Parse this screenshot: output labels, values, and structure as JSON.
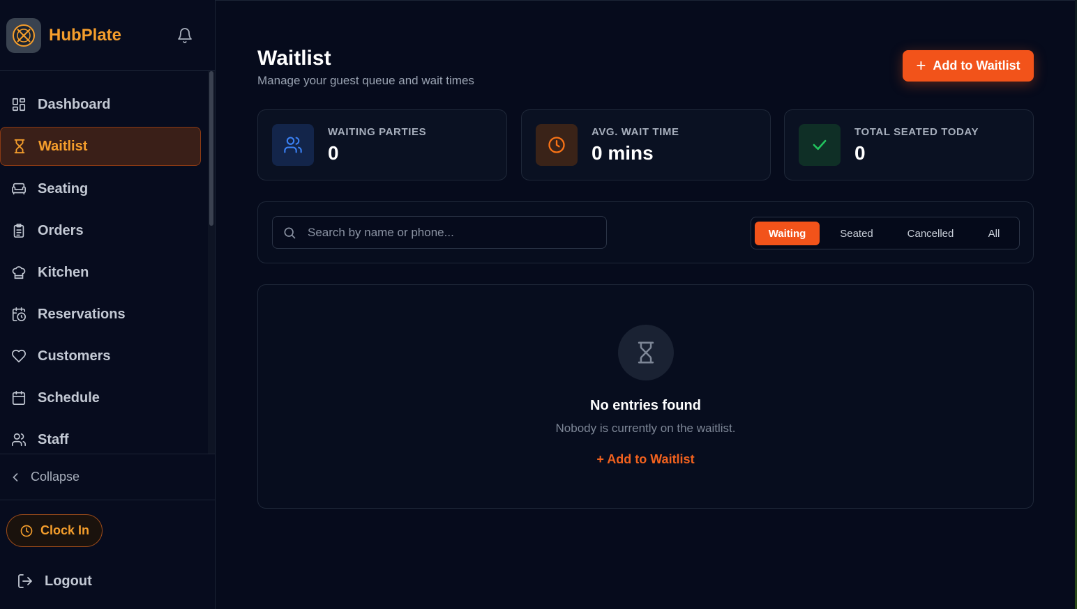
{
  "brand": {
    "name": "HubPlate"
  },
  "sidebar": {
    "items": [
      {
        "label": "Dashboard",
        "icon": "dashboard-icon"
      },
      {
        "label": "Waitlist",
        "icon": "hourglass-icon",
        "active": true
      },
      {
        "label": "Seating",
        "icon": "sofa-icon"
      },
      {
        "label": "Orders",
        "icon": "clipboard-icon"
      },
      {
        "label": "Kitchen",
        "icon": "chef-hat-icon"
      },
      {
        "label": "Reservations",
        "icon": "calendar-clock-icon"
      },
      {
        "label": "Customers",
        "icon": "heart-icon"
      },
      {
        "label": "Schedule",
        "icon": "calendar-icon"
      },
      {
        "label": "Staff",
        "icon": "users-icon"
      }
    ],
    "collapse_label": "Collapse",
    "clock_in_label": "Clock In",
    "logout_label": "Logout"
  },
  "header": {
    "title": "Waitlist",
    "subtitle": "Manage your guest queue and wait times",
    "add_button_label": "Add to Waitlist"
  },
  "stats": [
    {
      "label": "WAITING PARTIES",
      "value": "0",
      "icon": "users-icon",
      "color": "#3b82f6"
    },
    {
      "label": "AVG. WAIT TIME",
      "value": "0 mins",
      "icon": "clock-icon",
      "color": "#f97316"
    },
    {
      "label": "TOTAL SEATED TODAY",
      "value": "0",
      "icon": "check-icon",
      "color": "#22c55e"
    }
  ],
  "filters": {
    "search_placeholder": "Search by name or phone...",
    "tabs": [
      "Waiting",
      "Seated",
      "Cancelled",
      "All"
    ],
    "active_tab": "Waiting"
  },
  "empty_state": {
    "title": "No entries found",
    "subtitle": "Nobody is currently on the waitlist.",
    "link_label": "+ Add to Waitlist"
  },
  "colors": {
    "accent": "#f2531a",
    "brand": "#f59e2c",
    "background": "#060b1c"
  }
}
